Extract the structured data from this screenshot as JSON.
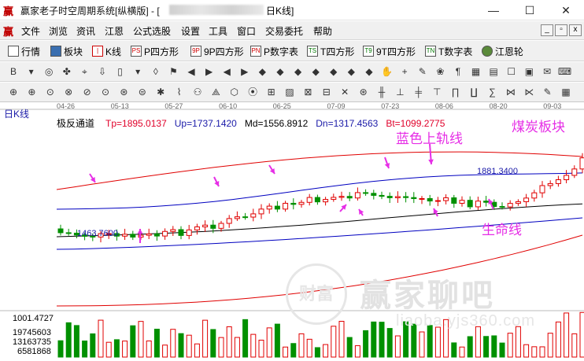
{
  "window": {
    "title": "赢家老子时空周期系统[纵横版] - [",
    "title_suffix": "日K线]",
    "controls": [
      "—",
      "☐",
      "✕"
    ]
  },
  "menu": {
    "items": [
      "文件",
      "浏览",
      "资讯",
      "江恩",
      "公式选股",
      "设置",
      "工具",
      "窗口",
      "交易委托",
      "帮助"
    ],
    "mdi_controls": [
      "_",
      "▫",
      "x"
    ]
  },
  "toolbar1": {
    "items": [
      {
        "label": "行情",
        "icon": "grid-icon"
      },
      {
        "label": "板块",
        "icon": "blocks-icon"
      },
      {
        "label": "K线",
        "icon": "candle-icon"
      },
      {
        "label": "P四方形",
        "icon": "PS"
      },
      {
        "label": "9P四方形",
        "icon": "9P"
      },
      {
        "label": "P数字表",
        "icon": "PN"
      },
      {
        "label": "T四方形",
        "icon": "TS"
      },
      {
        "label": "9T四方形",
        "icon": "T9"
      },
      {
        "label": "T数字表",
        "icon": "TN"
      },
      {
        "label": "江恩轮",
        "icon": "wheel-icon"
      }
    ]
  },
  "toolbar2_icons": [
    "B",
    "▾",
    "◎",
    "✤",
    "⌖",
    "⇩",
    "▯",
    "▾",
    "◊",
    "⚑",
    "◀",
    "▶",
    "◀",
    "▶",
    "◆",
    "◆",
    "◆",
    "◆",
    "◆",
    "◆",
    "◆",
    "✋",
    "+",
    "✎",
    "❀",
    "¶",
    "▦",
    "▤",
    "☐",
    "▣",
    "✉",
    "⌨"
  ],
  "toolbar3_icons": [
    "⊕",
    "⊕",
    "⊙",
    "⊗",
    "⊘",
    "⊙",
    "⊛",
    "⊜",
    "✱",
    "⌇",
    "⚇",
    "⟁",
    "⬡",
    "⦿",
    "⊞",
    "▨",
    "⊠",
    "⊟",
    "✕",
    "⊛",
    "╫",
    "⊥",
    "╪",
    "⊤",
    "∏",
    "∐",
    "∑",
    "⋈",
    "⋉",
    "✎",
    "▦"
  ],
  "chart": {
    "period": "日K线",
    "indicator": {
      "name": "极反通道",
      "tp": "Tp=1895.0137",
      "up": "Up=1737.1420",
      "md": "Md=1556.8912",
      "dn": "Dn=1317.4563",
      "bt": "Bt=1099.2775"
    },
    "date_ticks": [
      "04-26",
      "05-13",
      "05-27",
      "06-10",
      "06-25",
      "07-09",
      "07-23",
      "08-06",
      "08-20",
      "09-03"
    ],
    "annotations": {
      "sector": "煤炭板块",
      "upper_band": "蓝色上轨线",
      "life_line": "生命线"
    },
    "price_labels": {
      "high": "1881.3400",
      "low": "1463.7600"
    },
    "volume_axis": [
      "1001.4727",
      "19745603",
      "13163735",
      "6581868"
    ],
    "watermark": {
      "brand": "赢家聊吧",
      "url": "liaoba.yjs360.com",
      "seal": "财富"
    },
    "colors": {
      "up": "#e00000",
      "down": "#009000",
      "upper_band": "#0000c0",
      "red_band": "#e00000",
      "mid": "#000000",
      "arrow": "#e62ee6"
    }
  },
  "chart_data": {
    "type": "line",
    "series": [],
    "candle_count": 66,
    "price_range": [
      1099.2775,
      1895.0137
    ]
  }
}
